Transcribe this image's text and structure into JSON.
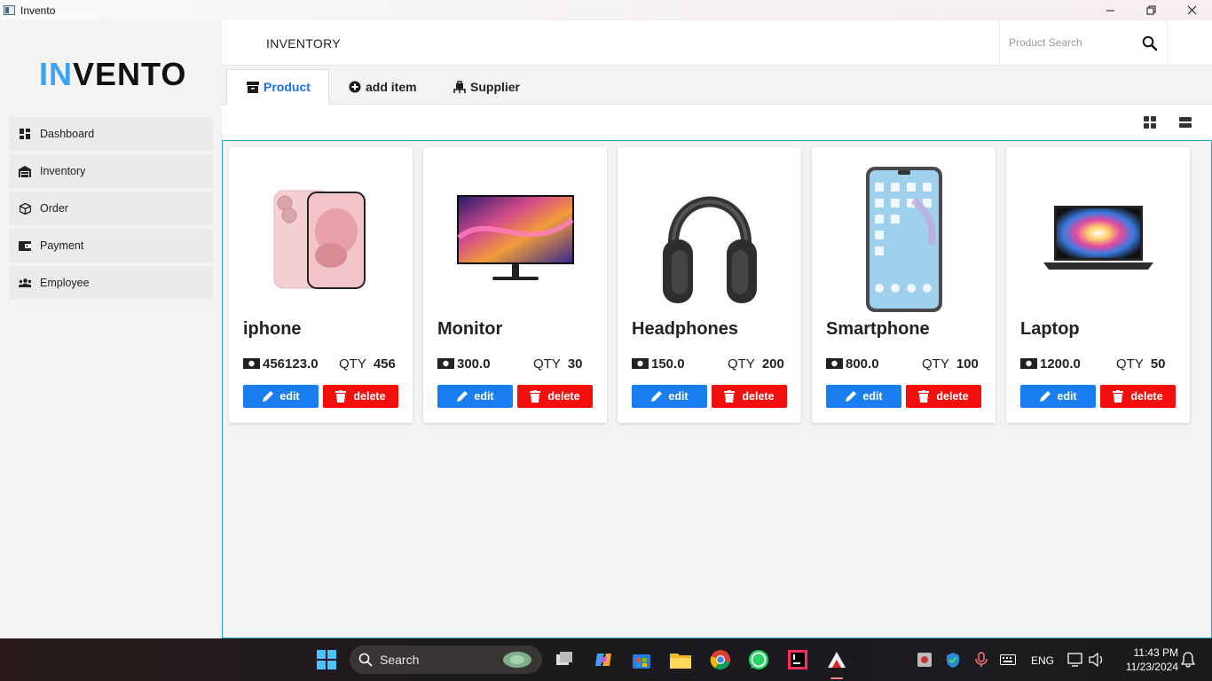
{
  "window": {
    "title": "Invento"
  },
  "sidebar": {
    "logo": {
      "accent": "IN",
      "rest": "VENTO"
    },
    "items": [
      {
        "label": "Dashboard",
        "icon": "dashboard-icon"
      },
      {
        "label": "Inventory",
        "icon": "warehouse-icon"
      },
      {
        "label": "Order",
        "icon": "box-icon"
      },
      {
        "label": "Payment",
        "icon": "wallet-icon"
      },
      {
        "label": "Employee",
        "icon": "users-icon"
      }
    ]
  },
  "header": {
    "title": "INVENTORY",
    "search_placeholder": "Product Search"
  },
  "tabs": [
    {
      "label": "Product",
      "icon": "archive-icon",
      "active": true
    },
    {
      "label": "add item",
      "icon": "plus-circle-icon",
      "active": false
    },
    {
      "label": "Supplier",
      "icon": "dolly-icon",
      "active": false
    }
  ],
  "products": [
    {
      "name": "iphone",
      "price": "456123.0",
      "qty_label": "QTY",
      "qty": "456",
      "image": "iphone-image"
    },
    {
      "name": "Monitor",
      "price": "300.0",
      "qty_label": "QTY",
      "qty": "30",
      "image": "monitor-image"
    },
    {
      "name": "Headphones",
      "price": "150.0",
      "qty_label": "QTY",
      "qty": "200",
      "image": "headphones-image"
    },
    {
      "name": "Smartphone",
      "price": "800.0",
      "qty_label": "QTY",
      "qty": "100",
      "image": "smartphone-image"
    },
    {
      "name": "Laptop",
      "price": "1200.0",
      "qty_label": "QTY",
      "qty": "50",
      "image": "laptop-image"
    }
  ],
  "buttons": {
    "edit": "edit",
    "delete": "delete"
  },
  "colors": {
    "accent": "#1b73e8",
    "edit": "#1a7df0",
    "delete": "#f40e0e",
    "logo_accent": "#3ba3f5",
    "border": "#29a4c7"
  },
  "taskbar": {
    "search_label": "Search",
    "language": "ENG",
    "time": "11:43 PM",
    "date": "11/23/2024"
  }
}
